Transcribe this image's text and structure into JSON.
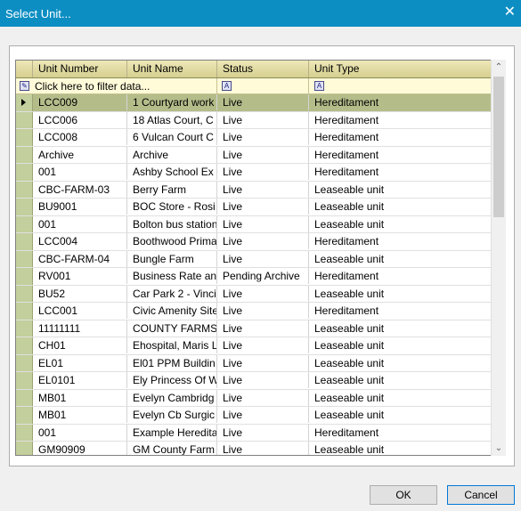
{
  "window": {
    "title": "Select Unit...",
    "close_glyph": "✕"
  },
  "grid": {
    "columns": [
      "Unit Number",
      "Unit Name",
      "Status",
      "Unit Type"
    ],
    "filter": {
      "text": "Click here to filter data...",
      "icon": "filter-edit-icon",
      "column_icon_glyph": "A"
    },
    "selected_row_index": 0,
    "rows": [
      [
        "LCC009",
        "1 Courtyard work",
        "Live",
        "Hereditament"
      ],
      [
        "LCC006",
        "18 Atlas Court, C",
        "Live",
        "Hereditament"
      ],
      [
        "LCC008",
        "6 Vulcan Court C",
        "Live",
        "Hereditament"
      ],
      [
        "Archive",
        "Archive",
        "Live",
        "Hereditament"
      ],
      [
        "001",
        "Ashby School Ex",
        "Live",
        "Hereditament"
      ],
      [
        "CBC-FARM-03",
        "Berry Farm",
        "Live",
        "Leaseable unit"
      ],
      [
        "BU9001",
        "BOC Store - Rosi",
        "Live",
        "Leaseable unit"
      ],
      [
        "001",
        "Bolton bus station",
        "Live",
        "Leaseable unit"
      ],
      [
        "LCC004",
        "Boothwood Prima",
        "Live",
        "Hereditament"
      ],
      [
        "CBC-FARM-04",
        "Bungle Farm",
        "Live",
        "Leaseable unit"
      ],
      [
        "RV001",
        "Business Rate an",
        "Pending Archive",
        "Hereditament"
      ],
      [
        "BU52",
        "Car Park 2 - Vinci",
        "Live",
        "Leaseable unit"
      ],
      [
        "LCC001",
        "Civic Amenity Site",
        "Live",
        "Hereditament"
      ],
      [
        "11111111",
        "COUNTY FARMS",
        "Live",
        "Leaseable unit"
      ],
      [
        "CH01",
        "Ehospital, Maris L",
        "Live",
        "Leaseable unit"
      ],
      [
        "EL01",
        "El01 PPM Buildin",
        "Live",
        "Leaseable unit"
      ],
      [
        "EL0101",
        "Ely Princess Of W",
        "Live",
        "Leaseable unit"
      ],
      [
        "MB01",
        "Evelyn Cambridg",
        "Live",
        "Leaseable unit"
      ],
      [
        "MB01",
        "Evelyn Cb Surgic",
        "Live",
        "Leaseable unit"
      ],
      [
        "001",
        "Example Heredita",
        "Live",
        "Hereditament"
      ],
      [
        "GM90909",
        "GM County Farm",
        "Live",
        "Leaseable unit"
      ]
    ]
  },
  "scrollbar": {
    "up_glyph": "⌃",
    "down_glyph": "⌄"
  },
  "buttons": {
    "ok": "OK",
    "cancel": "Cancel"
  }
}
